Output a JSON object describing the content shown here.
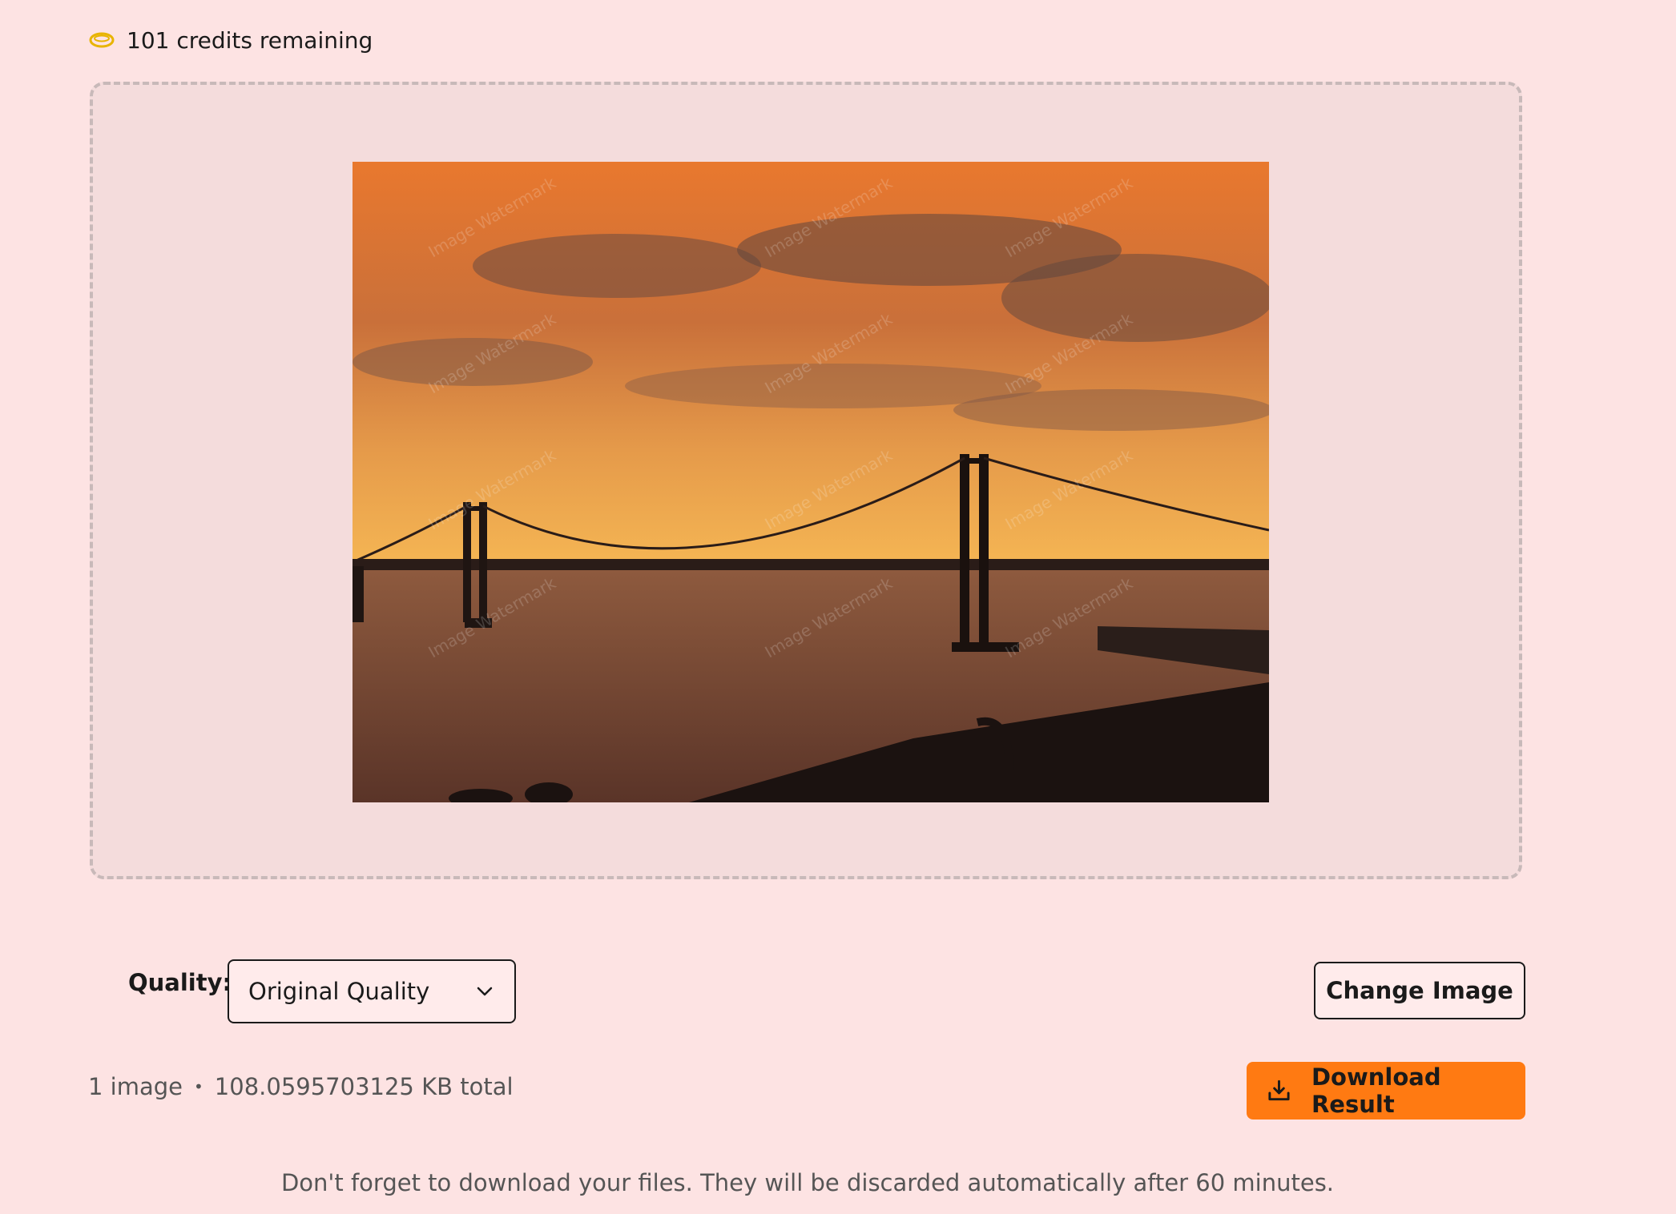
{
  "credits": {
    "text": "101 credits remaining",
    "icon": "coin-icon"
  },
  "preview": {
    "watermark_text": "Image Watermark"
  },
  "quality": {
    "label": "Quality:",
    "selected": "Original Quality"
  },
  "actions": {
    "change_image": "Change Image",
    "download": "Download Result"
  },
  "file_info": {
    "count": "1 image",
    "separator": "•",
    "size": "108.0595703125 KB total"
  },
  "notice": "Don't forget to download your files. They will be discarded automatically after 60 minutes.",
  "colors": {
    "page_bg": "#FDE3E3",
    "dropzone_bg": "#F4DCDC",
    "accent": "#FF7A12",
    "coin": "#E8B400"
  }
}
